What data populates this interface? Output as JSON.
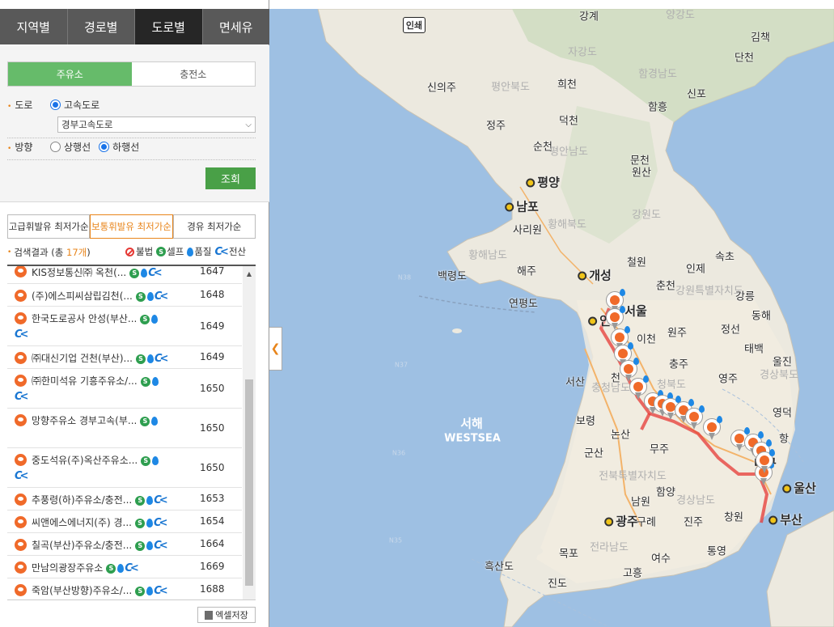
{
  "nav_tabs": [
    "지역별",
    "경로별",
    "도로별",
    "면세유"
  ],
  "type_tabs": [
    "주유소",
    "충전소"
  ],
  "form": {
    "road_label": "도로",
    "road_radio": "고속도로",
    "road_select": "경부고속도로",
    "direction_label": "방향",
    "direction_options": [
      "상행선",
      "하행선"
    ],
    "search_button": "조회"
  },
  "fuel_tabs": [
    "고급휘발유 최저가순",
    "보통휘발유 최저가순",
    "경유 최저가순"
  ],
  "result": {
    "prefix": "검색결과 (총",
    "count": "17개",
    "suffix": ")"
  },
  "legend": {
    "illegal": "불법",
    "self": "셀프",
    "quality": "품질",
    "ecard": "전산"
  },
  "stations": [
    {
      "name": "KIS정보통신㈜ 옥천(...",
      "price": "1647"
    },
    {
      "name": "(주)에스피씨삼립김천(...",
      "price": "1648"
    },
    {
      "name": "한국도로공사 안성(부산...",
      "price": "1649"
    },
    {
      "name": "㈜대신기업 건천(부산)...",
      "price": "1649"
    },
    {
      "name": "㈜한미석유 기흥주유소/...",
      "price": "1650"
    },
    {
      "name": "망향주유소 경부고속(부...",
      "price": "1650"
    },
    {
      "name": "중도석유(주)옥산주유소...",
      "price": "1650"
    },
    {
      "name": "추풍령(하)주유소/충전...",
      "price": "1653"
    },
    {
      "name": "씨앤에스에너지(주) 경...",
      "price": "1654"
    },
    {
      "name": "칠곡(부산)주유소/충전...",
      "price": "1664"
    },
    {
      "name": "만남의광장주유소",
      "price": "1669"
    },
    {
      "name": "죽암(부산방향)주유소/...",
      "price": "1688"
    }
  ],
  "excel_button": "엑셀저장",
  "map": {
    "mode_badge": "인쇄",
    "labels": {
      "ganggye": "강계",
      "yanggang": "양강도",
      "kimchaek": "김책",
      "jagang": "자강도",
      "dancheon": "단천",
      "hamnam": "함경남도",
      "sinuiju": "신의주",
      "pyeongbuk": "평안북도",
      "huicheon": "희천",
      "hamheung": "함흥",
      "sinpo": "신포",
      "deokcheon": "덕천",
      "jeongju": "정주",
      "suncheon": "순천",
      "pyeongnam": "평안남도",
      "muncheon": "문천",
      "wonsan": "원산",
      "pyongyang": "평양",
      "nampo": "남포",
      "gangwon_n": "강원도",
      "hwangbuk": "황해북도",
      "sariwon": "사리원",
      "hwangnam": "황해남도",
      "haeju": "해주",
      "baengnyeong": "백령도",
      "kaesong": "개성",
      "cheorwon": "철원",
      "inje": "인제",
      "sokcho": "속초",
      "yeonpyeong": "연평도",
      "chuncheon": "춘천",
      "gangwon_s": "강원특별자치도",
      "gangneung": "강릉",
      "seoul": "서울",
      "donghae": "동해",
      "incheon": "인",
      "icheon": "이천",
      "wonju": "원주",
      "jeongseon": "정선",
      "taebaek": "태백",
      "chungju": "충주",
      "uljin": "울진",
      "seosan": "서산",
      "chungnam": "충청남도",
      "cheon": "천",
      "chungbuk": "청북도",
      "yeongju": "영주",
      "gyeongbuk": "경상북도",
      "yeongdeok": "영덕",
      "westsea_ko": "서해",
      "westsea_en": "WESTSEA",
      "boryeong": "보령",
      "nonsan": "논산",
      "daegu": "대구",
      "hang": "항",
      "gunsan": "군산",
      "muju": "무주",
      "jeonbuk": "전북특별자치도",
      "ulsan": "울산",
      "namwon": "남원",
      "hamyang": "함양",
      "gyeongnam": "경상남도",
      "busan": "부산",
      "gwangju": "광주",
      "gurye": "구례",
      "jinju": "진주",
      "changwon": "창원",
      "heuksando": "흑산도",
      "mokpo": "목포",
      "jeonnam": "전라남도",
      "yeosu": "여수",
      "tongyeong": "통영",
      "goheung": "고흥",
      "jindo": "진도",
      "n38": "N38",
      "n37": "N37",
      "n36": "N36",
      "n35": "N35"
    }
  },
  "colors": {
    "accent_green": "#66bb6a",
    "button_green": "#49a047",
    "accent_orange": "#e8851b",
    "route_red": "#e53935"
  }
}
